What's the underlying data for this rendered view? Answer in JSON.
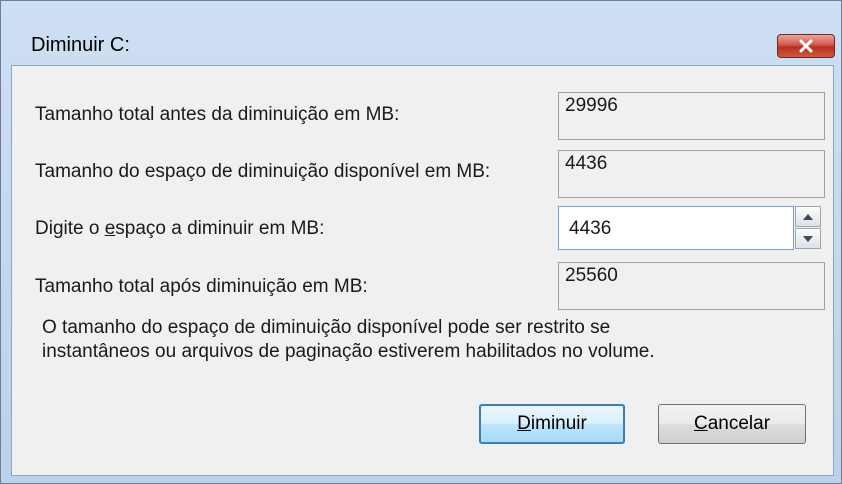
{
  "window": {
    "title": "Diminuir C:"
  },
  "rows": {
    "total_before": {
      "label": "Tamanho total antes da diminuição em MB:",
      "value": "29996"
    },
    "available": {
      "label": "Tamanho do espaço de diminuição disponível em MB:",
      "value": "4436"
    },
    "amount": {
      "label_pre": "Digite o ",
      "label_mn": "e",
      "label_post": "spaço a diminuir em MB:",
      "value": "4436"
    },
    "total_after": {
      "label": "Tamanho total após diminuição em MB:",
      "value": "25560"
    }
  },
  "note": {
    "line1": "O tamanho do espaço de diminuição disponível pode ser restrito se",
    "line2": "instantâneos ou arquivos de paginação estiverem habilitados no volume."
  },
  "buttons": {
    "shrink": {
      "mn": "D",
      "rest": "iminuir"
    },
    "cancel": {
      "mn": "C",
      "rest": "ancelar"
    }
  }
}
